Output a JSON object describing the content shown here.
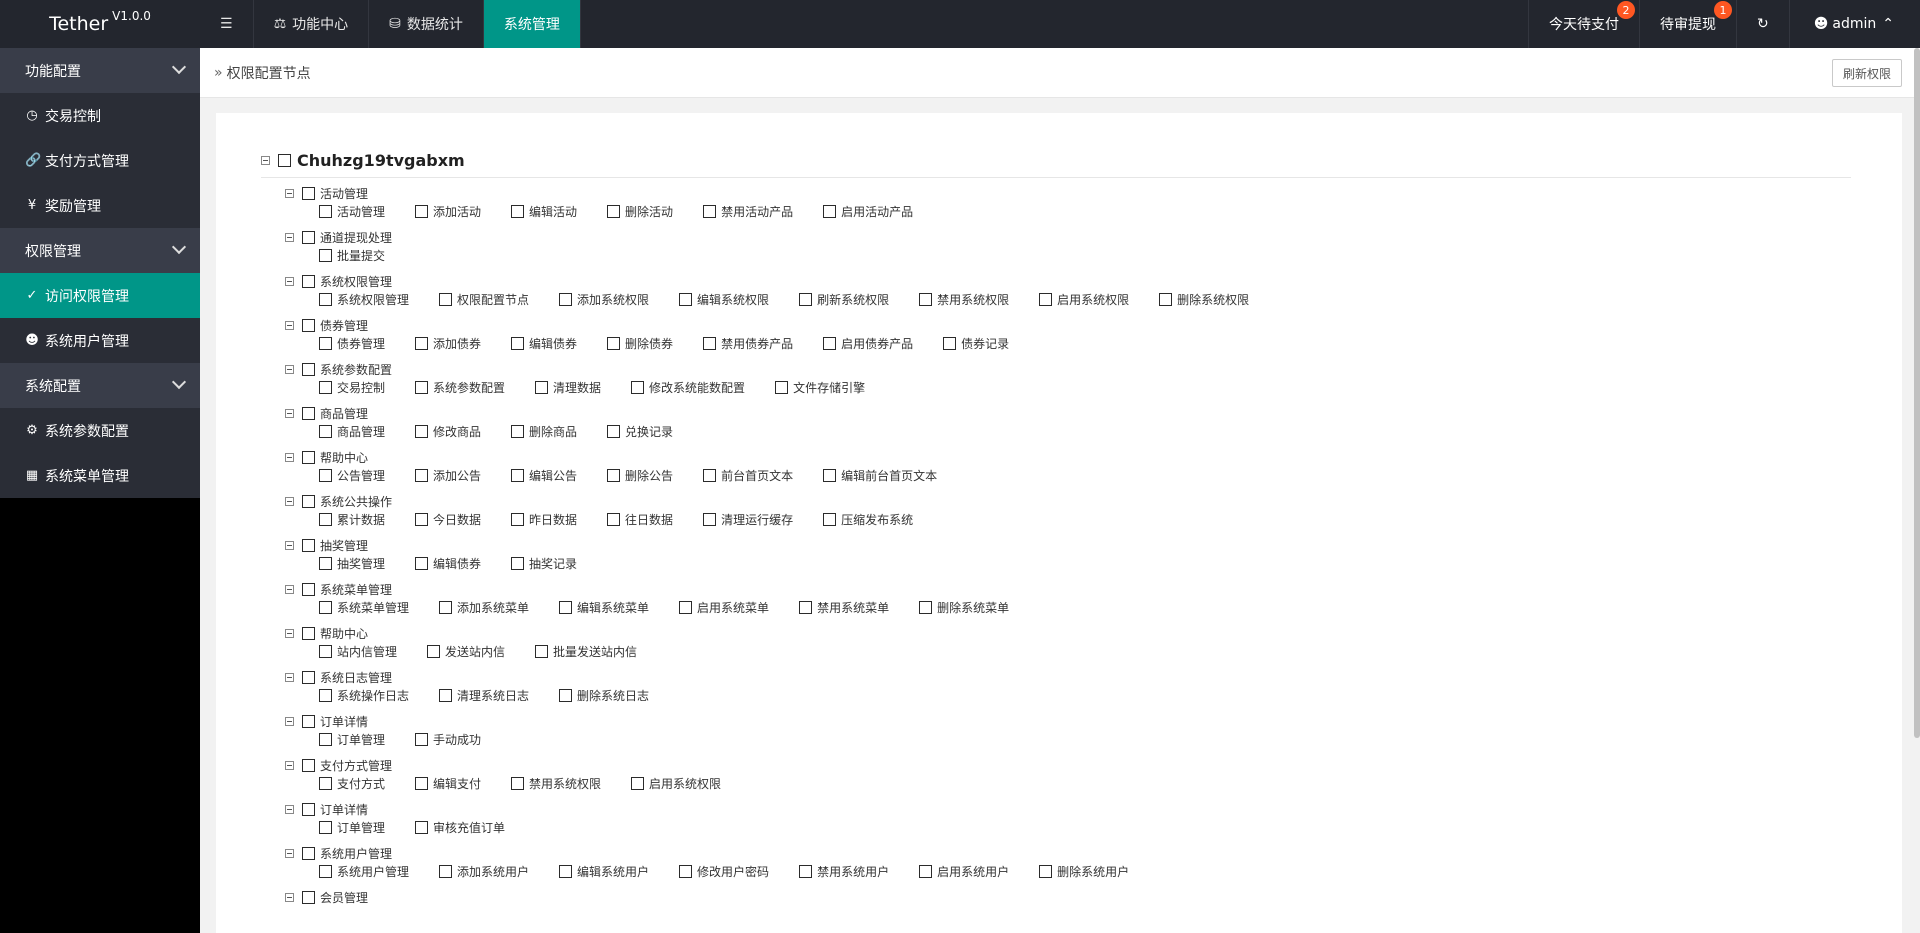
{
  "app": {
    "name": "Tether",
    "version": "V1.0.0"
  },
  "topnav": [
    {
      "label": "功能中心",
      "icon": "scale-icon"
    },
    {
      "label": "数据统计",
      "icon": "database-icon"
    },
    {
      "label": "系统管理",
      "icon": ""
    }
  ],
  "topright": {
    "pay_label": "今天待支付",
    "pay_count": "2",
    "withdraw_label": "待审提现",
    "withdraw_count": "1",
    "user": "admin"
  },
  "sidebar": [
    {
      "type": "group",
      "label": "功能配置"
    },
    {
      "type": "item",
      "label": "交易控制",
      "icon": "gauge-icon"
    },
    {
      "type": "item",
      "label": "支付方式管理",
      "icon": "link-icon"
    },
    {
      "type": "item",
      "label": "奖励管理",
      "icon": "yen-icon"
    },
    {
      "type": "group",
      "label": "权限管理"
    },
    {
      "type": "item",
      "label": "访问权限管理",
      "icon": "shield-icon",
      "active": true
    },
    {
      "type": "item",
      "label": "系统用户管理",
      "icon": "user-icon"
    },
    {
      "type": "group",
      "label": "系统配置"
    },
    {
      "type": "item",
      "label": "系统参数配置",
      "icon": "gear-icon"
    },
    {
      "type": "item",
      "label": "系统菜单管理",
      "icon": "calendar-icon"
    }
  ],
  "breadcrumb": {
    "title": "权限配置节点"
  },
  "refresh_label": "刷新权限",
  "tree": {
    "root": "Chuhzg19tvgabxm",
    "groups": [
      {
        "label": "活动管理",
        "children": [
          "活动管理",
          "添加活动",
          "编辑活动",
          "删除活动",
          "禁用活动产品",
          "启用活动产品"
        ]
      },
      {
        "label": "通道提现处理",
        "children": [
          "批量提交"
        ]
      },
      {
        "label": "系统权限管理",
        "children": [
          "系统权限管理",
          "权限配置节点",
          "添加系统权限",
          "编辑系统权限",
          "刷新系统权限",
          "禁用系统权限",
          "启用系统权限",
          "删除系统权限"
        ]
      },
      {
        "label": "债券管理",
        "children": [
          "债券管理",
          "添加债券",
          "编辑债券",
          "删除债券",
          "禁用债券产品",
          "启用债券产品",
          "债券记录"
        ]
      },
      {
        "label": "系统参数配置",
        "children": [
          "交易控制",
          "系统参数配置",
          "清理数据",
          "修改系统能数配置",
          "文件存储引擎"
        ]
      },
      {
        "label": "商品管理",
        "children": [
          "商品管理",
          "修改商品",
          "删除商品",
          "兑换记录"
        ]
      },
      {
        "label": "帮助中心",
        "children": [
          "公告管理",
          "添加公告",
          "编辑公告",
          "删除公告",
          "前台首页文本",
          "编辑前台首页文本"
        ]
      },
      {
        "label": "系统公共操作",
        "children": [
          "累计数据",
          "今日数据",
          "昨日数据",
          "往日数据",
          "清理运行缓存",
          "压缩发布系统"
        ]
      },
      {
        "label": "抽奖管理",
        "children": [
          "抽奖管理",
          "编辑债券",
          "抽奖记录"
        ]
      },
      {
        "label": "系统菜单管理",
        "children": [
          "系统菜单管理",
          "添加系统菜单",
          "编辑系统菜单",
          "启用系统菜单",
          "禁用系统菜单",
          "删除系统菜单"
        ]
      },
      {
        "label": "帮助中心",
        "children": [
          "站内信管理",
          "发送站内信",
          "批量发送站内信"
        ]
      },
      {
        "label": "系统日志管理",
        "children": [
          "系统操作日志",
          "清理系统日志",
          "删除系统日志"
        ]
      },
      {
        "label": "订单详情",
        "children": [
          "订单管理",
          "手动成功"
        ]
      },
      {
        "label": "支付方式管理",
        "children": [
          "支付方式",
          "编辑支付",
          "禁用系统权限",
          "启用系统权限"
        ]
      },
      {
        "label": "订单详情",
        "children": [
          "订单管理",
          "审核充值订单"
        ]
      },
      {
        "label": "系统用户管理",
        "children": [
          "系统用户管理",
          "添加系统用户",
          "编辑系统用户",
          "修改用户密码",
          "禁用系统用户",
          "启用系统用户",
          "删除系统用户"
        ]
      },
      {
        "label": "会员管理",
        "children": []
      }
    ]
  }
}
